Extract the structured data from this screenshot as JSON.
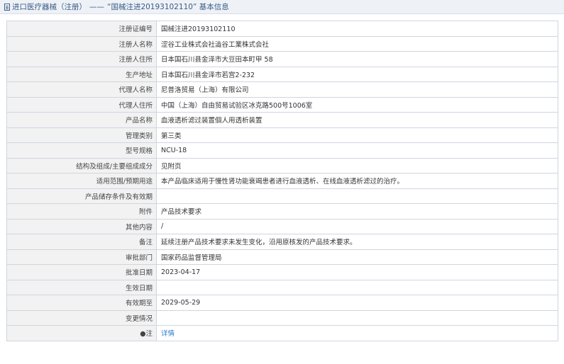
{
  "header": {
    "section": "进口医疗器械（注册）",
    "separator": "——",
    "title": "“国械注进20193102110” 基本信息"
  },
  "rows": [
    {
      "label": "注册证编号",
      "value": "国械注进20193102110"
    },
    {
      "label": "注册人名称",
      "value": "涩谷工业株式会社澁谷工業株式会社"
    },
    {
      "label": "注册人住所",
      "value": "日本国石川县金泽市大豆田本町甲 58"
    },
    {
      "label": "生产地址",
      "value": "日本国石川县金泽市若宫2-232"
    },
    {
      "label": "代理人名称",
      "value": "尼普洛贸易（上海）有限公司"
    },
    {
      "label": "代理人住所",
      "value": "中国（上海）自由贸易试验区冰克路500号1006室"
    },
    {
      "label": "产品名称",
      "value": "血液透析滤过装置個人用透析装置"
    },
    {
      "label": "管理类别",
      "value": "第三类"
    },
    {
      "label": "型号规格",
      "value": "NCU-18"
    },
    {
      "label": "结构及组成/主要组成成分",
      "value": "见附页"
    },
    {
      "label": "适用范围/预期用途",
      "value": "本产品临床适用于慢性肾功能衰竭患者进行血液透析、在线血液透析滤过的治疗。"
    },
    {
      "label": "产品储存条件及有效期",
      "value": ""
    },
    {
      "label": "附件",
      "value": "产品技术要求"
    },
    {
      "label": "其他内容",
      "value": "/"
    },
    {
      "label": "备注",
      "value": "延续注册产品技术要求未发生变化，沿用原核发的产品技术要求。"
    },
    {
      "label": "审批部门",
      "value": "国家药品监督管理局"
    },
    {
      "label": "批准日期",
      "value": "2023-04-17"
    },
    {
      "label": "生效日期",
      "value": ""
    },
    {
      "label": "有效期至",
      "value": "2029-05-29"
    },
    {
      "label": "变更情况",
      "value": ""
    }
  ],
  "note": {
    "label_mark": "●",
    "label": "注",
    "link": "详情"
  }
}
